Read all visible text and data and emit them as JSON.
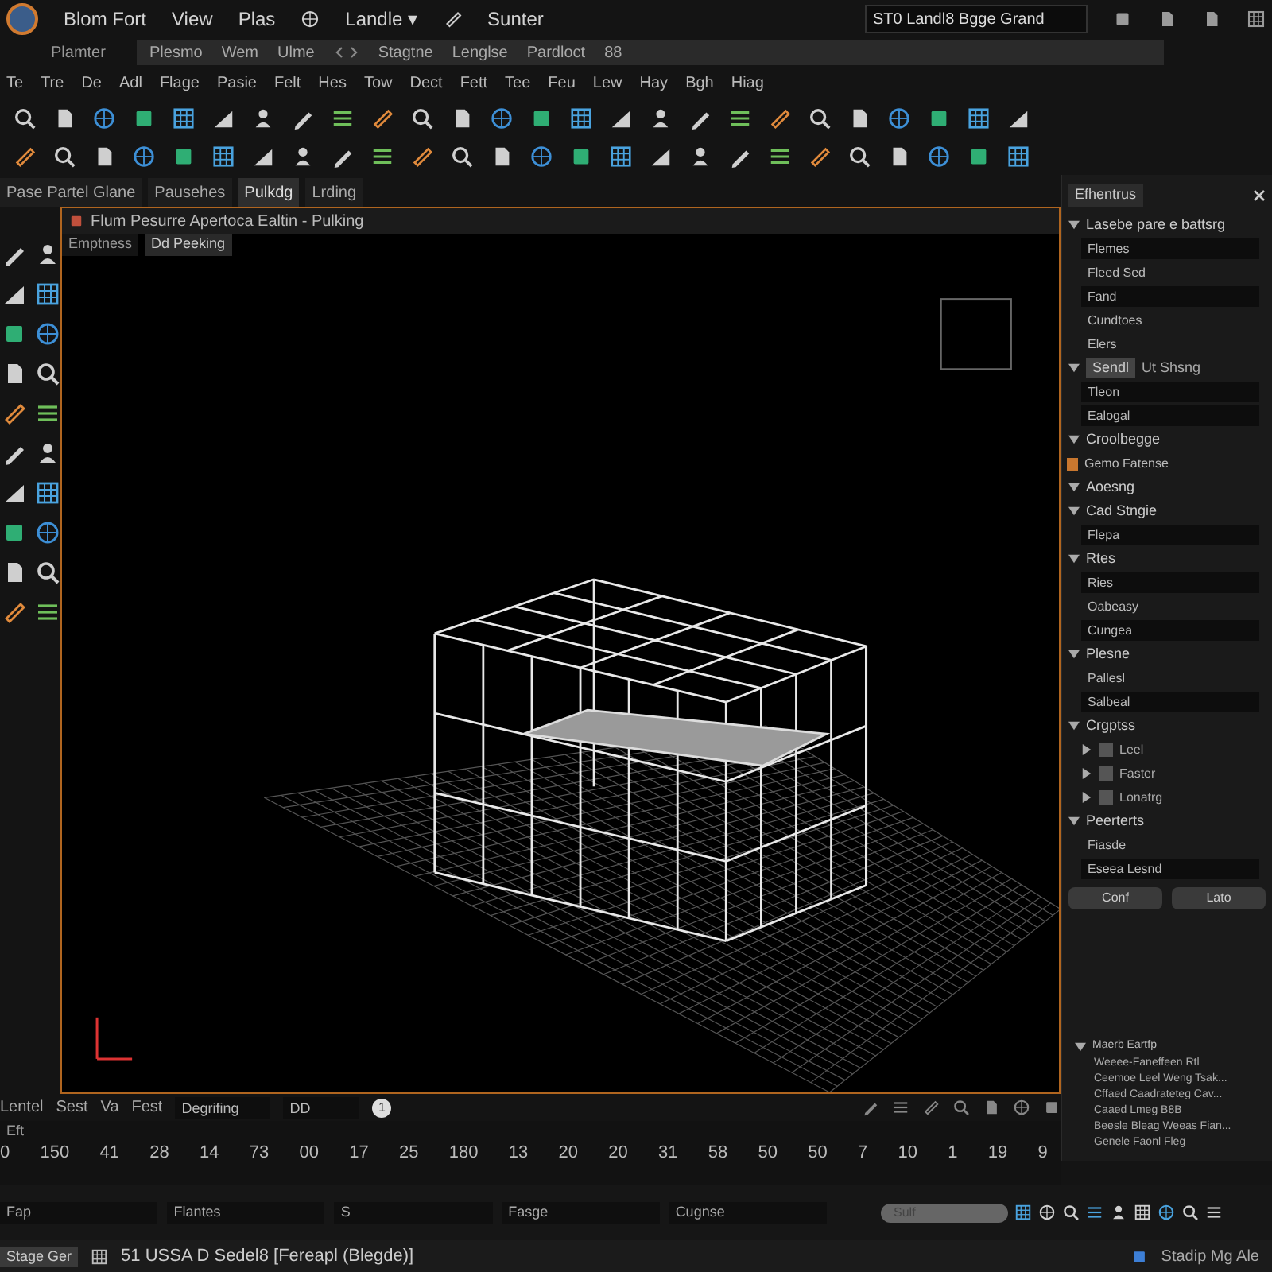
{
  "menu_bar": {
    "items": [
      "Blom Fort",
      "View",
      "Plas",
      "Landle ▾",
      "Sunter"
    ],
    "search": {
      "value": "ST0 Landl8 Bgge Grand"
    }
  },
  "nav_bar": {
    "label": "Plamter",
    "items": [
      "Plesmo",
      "Wem",
      "Ulme",
      "Stagtne",
      "Lenglse",
      "Pardloct",
      "88"
    ]
  },
  "secondary_menu": [
    "Te",
    "Tre",
    "De",
    "Adl",
    "Flage",
    "Pasie",
    "Felt",
    "Hes",
    "Tow",
    "Dect",
    "Fett",
    "Tee",
    "Feu",
    "Lew",
    "Hay",
    "Bgh",
    "Hiag"
  ],
  "document_tabs": [
    {
      "label": "Pase Partel Glane",
      "selected": false
    },
    {
      "label": "Pausehes",
      "selected": false
    },
    {
      "label": "Pulkdg",
      "selected": true
    },
    {
      "label": "Lrding",
      "selected": false
    }
  ],
  "viewport": {
    "title": "Flum Pesurre Apertoca Ealtin - Pulking",
    "tabs": [
      {
        "label": "Emptness",
        "selected": false
      },
      {
        "label": "Dd Peeking",
        "selected": true
      }
    ],
    "status": {
      "labels": [
        "Lentel",
        "Sest",
        "Va",
        "Fest"
      ],
      "field": "Degrifing",
      "value": "DD",
      "badge": "1"
    }
  },
  "panel": {
    "title": "Efhentrus",
    "sections": [
      {
        "label": "Lasebe pare e battsrg",
        "expanded": true,
        "children": [
          {
            "kind": "field",
            "text": "Flemes"
          },
          {
            "kind": "label",
            "text": "Fleed Sed"
          },
          {
            "kind": "field",
            "text": "Fand"
          },
          {
            "kind": "label",
            "text": "Cundtoes"
          },
          {
            "kind": "label",
            "text": "Elers"
          }
        ]
      },
      {
        "label": "Sendl",
        "tab2": "Ut Shsng",
        "expanded": true,
        "children": [
          {
            "kind": "field",
            "text": "Tleon"
          },
          {
            "kind": "field",
            "text": "Ealogal"
          }
        ]
      },
      {
        "label": "Croolbegge",
        "expanded": true,
        "children": [
          {
            "kind": "item",
            "text": "Gemo Fatense"
          }
        ]
      },
      {
        "label": "Aoesng",
        "expanded": true
      },
      {
        "label": "Cad Stngie",
        "expanded": true,
        "children": [
          {
            "kind": "field",
            "text": "Flepa"
          }
        ]
      },
      {
        "label": "Rtes",
        "expanded": true,
        "children": [
          {
            "kind": "field",
            "text": "Ries"
          },
          {
            "kind": "label",
            "text": "Oabeasy"
          },
          {
            "kind": "field",
            "text": "Cungea"
          }
        ]
      },
      {
        "label": "Plesne",
        "expanded": true,
        "children": [
          {
            "kind": "label",
            "text": "Pallesl"
          },
          {
            "kind": "field",
            "text": "Salbeal"
          }
        ]
      },
      {
        "label": "Crgptss",
        "expanded": true,
        "children": [
          {
            "kind": "checkbox",
            "text": "Leel",
            "checked": false,
            "expanded": false
          },
          {
            "kind": "checkbox",
            "text": "Faster",
            "checked": false,
            "expanded": false
          },
          {
            "kind": "checkbox",
            "text": "Lonatrg",
            "checked": false,
            "expanded": false
          }
        ]
      },
      {
        "label": "Peerterts",
        "expanded": true,
        "children": [
          {
            "kind": "label",
            "text": "Fiasde"
          },
          {
            "kind": "field",
            "text": "Eseea Lesnd"
          }
        ]
      }
    ],
    "buttons": [
      "Conf",
      "Lato"
    ],
    "list": {
      "label": "Maerb Eartfp",
      "expanded": true,
      "items": [
        "Weeee-Faneffeen Rtl",
        "Ceemoe Leel Weng Tsak...",
        "Cffaed Caadrateteg Cav...",
        "Caaed Lmeg B8B",
        "Beesle Bleag Weeas Fian...",
        "Genele Faonl Fleg"
      ]
    }
  },
  "timeline": {
    "label": "Eft",
    "ticks": [
      "0",
      "150",
      "41",
      "28",
      "14",
      "73",
      "00",
      "17",
      "25",
      "180",
      "13",
      "20",
      "20",
      "31",
      "58",
      "50",
      "50",
      "7",
      "10",
      "1",
      "19",
      "9"
    ]
  },
  "filters": [
    "Fap",
    "Flantes",
    "S",
    "Fasge",
    "Cugnse"
  ],
  "bottom_search": {
    "placeholder": "Sulf"
  },
  "status_bar": {
    "left": "Stage Ger",
    "text": "51 USSA D Sedel8 [Fereapl (Blegde)]",
    "right": "Stadip Mg Ale"
  }
}
